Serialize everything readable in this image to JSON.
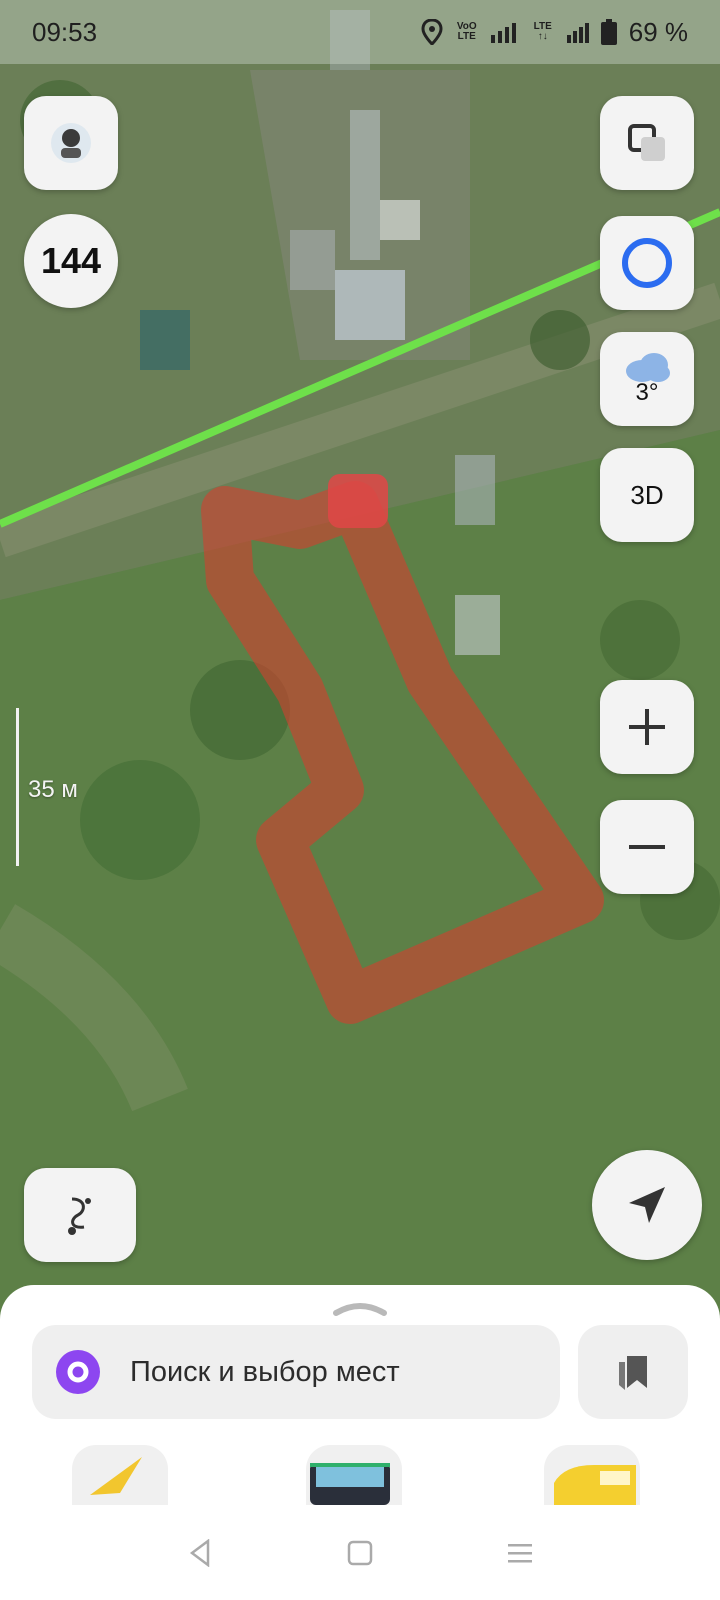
{
  "status_bar": {
    "time": "09:53",
    "volte_top": "VoO",
    "volte_bottom": "LTE",
    "lte_top": "LTE",
    "lte_bottom": "↑↓",
    "battery_text": "69 %",
    "icons": [
      "location-icon",
      "signal-icon",
      "battery-icon"
    ]
  },
  "map": {
    "traffic_score": "144",
    "weather_temp": "3°",
    "mode_label": "3D",
    "scale_label": "35 м",
    "colors": {
      "route": "#6ee04a",
      "area_outline": "#d2402e"
    }
  },
  "controls": [
    "avatar-button",
    "layers-button",
    "alice-button",
    "weather-button",
    "3d-button",
    "zoom-in-button",
    "zoom-out-button",
    "route-button",
    "my-location-button"
  ],
  "bottom_sheet": {
    "search_placeholder": "Поиск и выбор мест",
    "tiles": [
      "navigator-tile",
      "transport-tile",
      "taxi-tile"
    ]
  },
  "nav_bar": [
    "back-icon",
    "home-icon",
    "menu-icon"
  ]
}
